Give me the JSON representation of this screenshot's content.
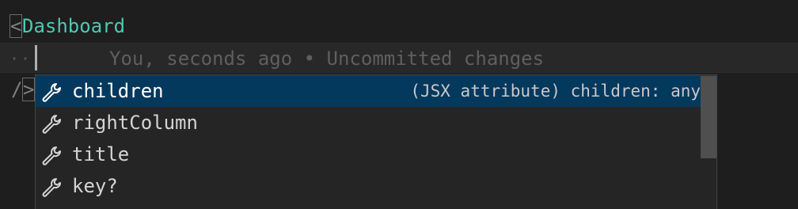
{
  "editor": {
    "line1": {
      "open_bracket": "<",
      "tag": "Dashboard"
    },
    "line2": {
      "indent_dots": "··",
      "blame": "You, seconds ago • Uncommitted changes"
    },
    "line3": {
      "slash": "/",
      "bracket": ">"
    }
  },
  "suggest": {
    "items": [
      {
        "label": "children",
        "detail": "(JSX attribute) children: any",
        "icon": "wrench-icon",
        "selected": true
      },
      {
        "label": "rightColumn",
        "detail": "",
        "icon": "wrench-icon",
        "selected": false
      },
      {
        "label": "title",
        "detail": "",
        "icon": "wrench-icon",
        "selected": false
      },
      {
        "label": "key?",
        "detail": "",
        "icon": "wrench-icon",
        "selected": false
      }
    ]
  },
  "colors": {
    "background": "#1e1e1e",
    "tag": "#4ec9b0",
    "selection": "#04395e",
    "blame": "#5f5f5f"
  }
}
